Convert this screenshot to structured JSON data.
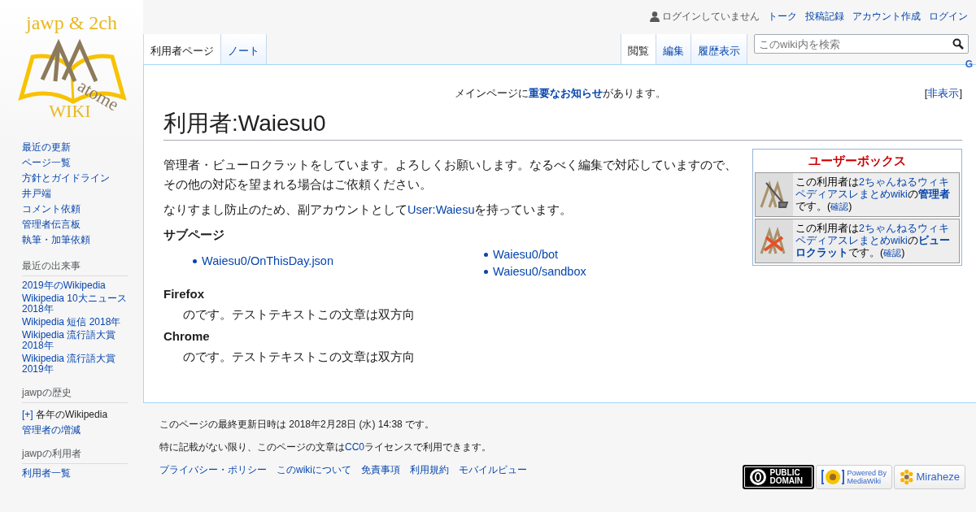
{
  "logo": {
    "line1": "jawp & 2ch",
    "line2": "atome",
    "line3": "WIKI"
  },
  "personal_tools": {
    "status": "ログインしていません",
    "links": [
      "トーク",
      "投稿記録",
      "アカウント作成",
      "ログイン"
    ]
  },
  "namespace_tabs": [
    {
      "label": "利用者ページ",
      "selected": true
    },
    {
      "label": "ノート",
      "selected": false
    }
  ],
  "view_tabs": [
    {
      "label": "閲覧",
      "selected": true
    },
    {
      "label": "編集",
      "selected": false
    },
    {
      "label": "履歴表示",
      "selected": false
    }
  ],
  "search": {
    "placeholder": "このwiki内を検索"
  },
  "corner_mark": "G",
  "sidebar": {
    "main": [
      "最近の更新",
      "ページ一覧",
      "方針とガイドライン",
      "井戸端",
      "コメント依頼",
      "管理者伝言板",
      "執筆・加筆依頼"
    ],
    "portals": [
      {
        "title": "最近の出来事",
        "items": [
          {
            "label": "2019年のWikipedia"
          },
          {
            "label": "Wikipedia 10大ニュース 2018年"
          },
          {
            "label": "Wikipedia 短信 2018年"
          },
          {
            "label": "Wikipedia 流行語大賞 2018年"
          },
          {
            "label": "Wikipedia 流行語大賞 2019年"
          }
        ]
      },
      {
        "title": "jawpの歴史",
        "items": [
          {
            "label": "各年のWikipedia",
            "toggle": "[+]"
          },
          {
            "label": "管理者の増減"
          }
        ]
      },
      {
        "title": "jawpの利用者",
        "items": [
          {
            "label": "利用者一覧"
          }
        ]
      }
    ]
  },
  "sitenotice": {
    "parts": [
      {
        "kind": "text",
        "text": "メインページに"
      },
      {
        "kind": "link",
        "text": "重要なお知らせ",
        "bold": true
      },
      {
        "kind": "text",
        "text": "があります。"
      }
    ],
    "hide_open": "[",
    "hide": "非表示",
    "hide_close": "]"
  },
  "title": "利用者:Waiesu0",
  "paragraphs": [
    [
      {
        "kind": "text",
        "text": "管理者・ビューロクラットをしています。よろしくお願いします。なるべく編集で対応していますので、その他の対応を望まれる場合はご依頼ください。"
      }
    ],
    [
      {
        "kind": "text",
        "text": "なりすまし防止のため、副アカウントとして"
      },
      {
        "kind": "link",
        "text": "User:Waiesu"
      },
      {
        "kind": "text",
        "text": "を持っています。"
      }
    ]
  ],
  "subpages": {
    "heading": "サブページ",
    "columns": [
      [
        "Waiesu0/OnThisDay.json"
      ],
      [
        "Waiesu0/bot",
        "Waiesu0/sandbox"
      ]
    ]
  },
  "sections": [
    {
      "heading": "Firefox",
      "text": "のです。テストテキストこの文章は双方向"
    },
    {
      "heading": "Chrome",
      "text": "のです。テストテキストこの文章は双方向"
    }
  ],
  "userbox": {
    "title": "ユーザーボックス",
    "boxes": [
      {
        "kind": "admin",
        "parts": [
          {
            "kind": "text",
            "text": "この利用者は"
          },
          {
            "kind": "link",
            "text": "2ちゃんねるウィキペディアスレまとめwiki"
          },
          {
            "kind": "text",
            "text": "の"
          },
          {
            "kind": "link",
            "text": "管理者",
            "bold": true
          },
          {
            "kind": "text",
            "text": "です。("
          },
          {
            "kind": "link",
            "text": "確認",
            "small": true
          },
          {
            "kind": "text",
            "text": ")"
          }
        ]
      },
      {
        "kind": "bureaucrat",
        "parts": [
          {
            "kind": "text",
            "text": "この利用者は"
          },
          {
            "kind": "link",
            "text": "2ちゃんねるウィキペディアスレまとめwiki"
          },
          {
            "kind": "text",
            "text": "の"
          },
          {
            "kind": "link",
            "text": "ビューロクラット",
            "bold": true
          },
          {
            "kind": "text",
            "text": "です。("
          },
          {
            "kind": "link",
            "text": "確認",
            "small": true
          },
          {
            "kind": "text",
            "text": ")"
          }
        ]
      }
    ]
  },
  "footer": {
    "info": [
      [
        {
          "kind": "text",
          "text": "このページの最終更新日時は 2018年2月28日 (水) 14:38 です。"
        }
      ],
      [
        {
          "kind": "text",
          "text": "特に記載がない限り、このページの文章は"
        },
        {
          "kind": "link",
          "text": "CC0"
        },
        {
          "kind": "text",
          "text": "ライセンスで利用できます。"
        }
      ]
    ],
    "links": [
      "プライバシー・ポリシー",
      "このwikiについて",
      "免責事項",
      "利用規約",
      "モバイルビュー"
    ],
    "badges": [
      {
        "kind": "public-domain",
        "lines": [
          "PUBLIC",
          "DOMAIN"
        ]
      },
      {
        "kind": "mediawiki",
        "lines": [
          "Powered By",
          "MediaWiki"
        ]
      },
      {
        "kind": "miraheze",
        "lines": [
          "Miraheze"
        ]
      }
    ]
  }
}
